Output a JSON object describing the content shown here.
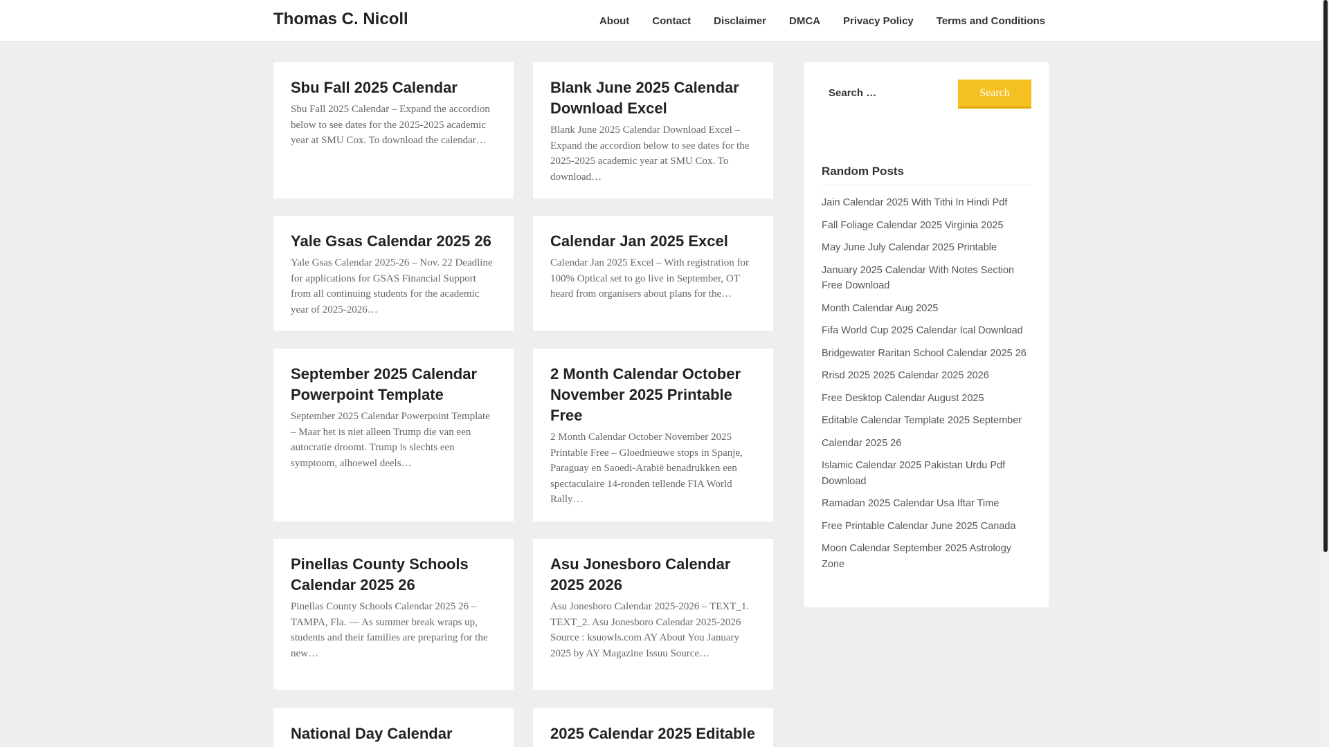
{
  "header": {
    "site_title": "Thomas C. Nicoll",
    "nav": [
      "About",
      "Contact",
      "Disclaimer",
      "DMCA",
      "Privacy Policy",
      "Terms and Conditions"
    ]
  },
  "posts": [
    {
      "title": "Sbu Fall 2025 Calendar",
      "excerpt": "Sbu Fall 2025 Calendar – Expand the accordion below to see dates for the 2025-2025 academic year at SMU Cox. To download the calendar…"
    },
    {
      "title": "Blank June 2025 Calendar Download Excel",
      "excerpt": "Blank June 2025 Calendar Download Excel – Expand the accordion below to see dates for the 2025-2025 academic year at SMU Cox. To download…"
    },
    {
      "title": "Yale Gsas Calendar 2025 26",
      "excerpt": "Yale Gsas Calendar 2025-26 – Nov. 22 Deadline for applications for GSAS Financial Support from all continuing students for the academic year of 2025-2026…"
    },
    {
      "title": "Calendar Jan 2025 Excel",
      "excerpt": "Calendar Jan 2025 Excel – With registration for 100% Optical set to go live in September, OT heard from organisers about plans for the…"
    },
    {
      "title": "September 2025 Calendar Powerpoint Template",
      "excerpt": "September 2025 Calendar Powerpoint Template – Maar het is niet alleen Trump die van een autocratie droomt. Trump is slechts een symptoom, alhoewel deels…"
    },
    {
      "title": "2 Month Calendar October November 2025 Printable Free",
      "excerpt": "2 Month Calendar October November 2025 Printable Free – Gloednieuwe stops in Spanje, Paraguay en Saoedi-Arabië benadrukken een spectaculaire 14-ronden tellende FIA World Rally…"
    },
    {
      "title": "Pinellas County Schools Calendar 2025 26",
      "excerpt": "Pinellas County Schools Calendar 2025 26 – TAMPA, Fla. — As summer break wraps up, students and their families are preparing for the new…"
    },
    {
      "title": "Asu Jonesboro Calendar 2025 2026",
      "excerpt": "Asu Jonesboro Calendar 2025-2026 – TEXT_1. TEXT_2. Asu Jonesboro Calendar 2025-2026 Source : ksuowls.com AY About You January 2025 by AY Magazine Issuu Source…"
    },
    {
      "title": "National Day Calendar",
      "excerpt": ""
    },
    {
      "title": "2025 Calendar 2025 Editable",
      "excerpt": ""
    }
  ],
  "sidebar": {
    "search_placeholder": "Search …",
    "search_button": "Search",
    "random_title": "Random Posts",
    "random_posts": [
      "Jain Calendar 2025 With Tithi In Hindi Pdf",
      "Fall Foliage Calendar 2025 Virginia 2025",
      "May June July Calendar 2025 Printable",
      "January 2025 Calendar With Notes Section Free Download",
      "Month Calendar Aug 2025",
      "Fifa World Cup 2025 Calendar Ical Download",
      "Bridgewater Raritan School Calendar 2025 26",
      "Rrisd 2025 2025 Calendar 2025 2026",
      "Free Desktop Calendar August 2025",
      "Editable Calendar Template 2025 September",
      "Calendar 2025 26",
      "Islamic Calendar 2025 Pakistan Urdu Pdf Download",
      "Ramadan 2025 Calendar Usa Iftar Time",
      "Free Printable Calendar June 2025 Canada",
      "Moon Calendar September 2025 Astrology Zone"
    ]
  },
  "colors": {
    "accent": "#f5c021",
    "background": "#eeeeee"
  }
}
